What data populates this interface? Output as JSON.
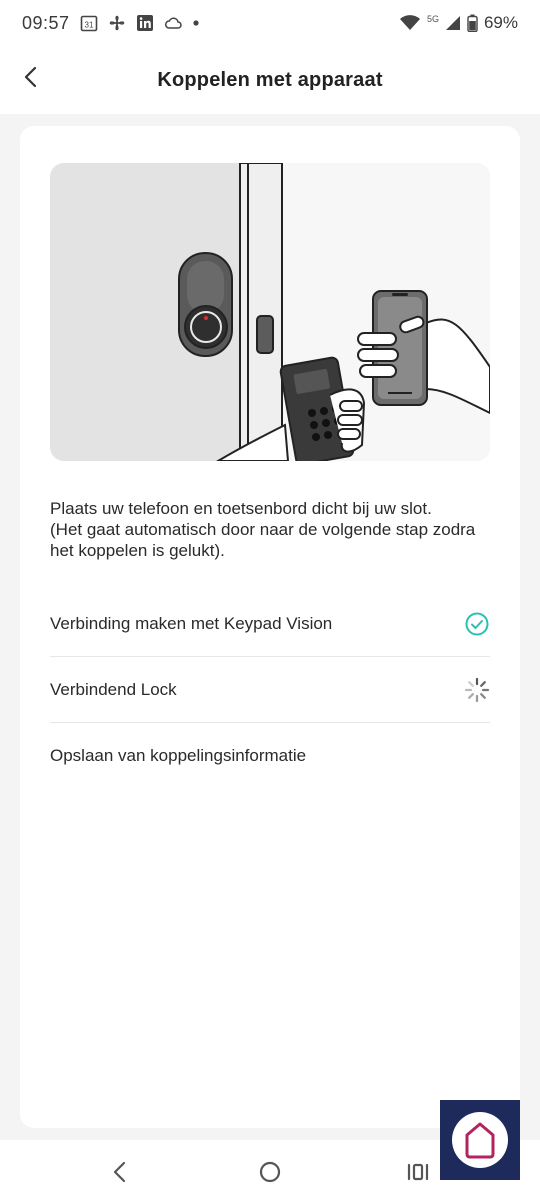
{
  "status_bar": {
    "time": "09:57",
    "battery": "69%",
    "network": "5G",
    "icons": [
      "calendar-icon",
      "fan-icon",
      "linkedin-icon",
      "cloud-icon",
      "dot-icon",
      "wifi-icon",
      "signal-icon",
      "battery-icon"
    ],
    "calendar_day": "31"
  },
  "header": {
    "title": "Koppelen met apparaat",
    "back_icon": "chevron-left-icon"
  },
  "instruction": {
    "line1": "Plaats uw telefoon en toetsenbord dicht bij uw slot.",
    "line2": "(Het gaat automatisch door naar de volgende stap zodra het koppelen is gelukt)."
  },
  "steps": [
    {
      "label": "Verbinding maken met Keypad Vision",
      "status": "done"
    },
    {
      "label": "Verbindend Lock",
      "status": "in-progress"
    },
    {
      "label": "Opslaan van koppelingsinformatie",
      "status": "pending"
    }
  ],
  "colors": {
    "accent": "#2bbfb3",
    "background": "#f4f4f4",
    "card": "#ffffff",
    "fab_bg": "#1f2a5c",
    "fab_icon": "#b3245e"
  }
}
